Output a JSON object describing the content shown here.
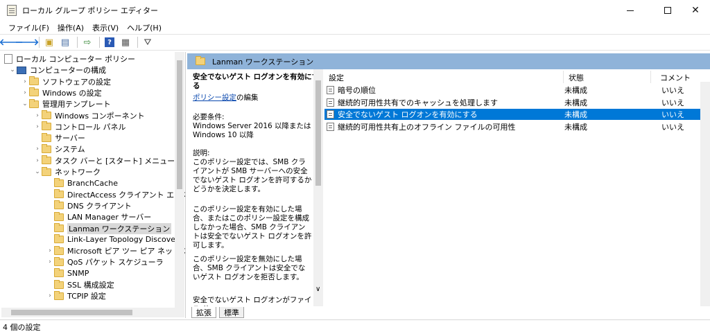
{
  "window": {
    "title": "ローカル グループ ポリシー エディター"
  },
  "menu": [
    "ファイル(F)",
    "操作(A)",
    "表示(V)",
    "ヘルプ(H)"
  ],
  "tree": [
    {
      "label": "ローカル コンピューター ポリシー",
      "icon": "document-icon",
      "expander": ""
    },
    {
      "label": "コンピューターの構成",
      "icon": "computer-icon",
      "expander": "expanded"
    },
    {
      "label": "ソフトウェアの設定",
      "icon": "folder-icon",
      "expander": "collapsed"
    },
    {
      "label": "Windows の設定",
      "icon": "folder-icon",
      "expander": "collapsed"
    },
    {
      "label": "管理用テンプレート",
      "icon": "folder-icon",
      "expander": "expanded"
    },
    {
      "label": "Windows コンポーネント",
      "icon": "folder-icon",
      "expander": "collapsed"
    },
    {
      "label": "コントロール パネル",
      "icon": "folder-icon",
      "expander": "collapsed"
    },
    {
      "label": "サーバー",
      "icon": "folder-icon",
      "expander": ""
    },
    {
      "label": "システム",
      "icon": "folder-icon",
      "expander": "collapsed"
    },
    {
      "label": "タスク バーと [スタート] メニュー",
      "icon": "folder-icon",
      "expander": "collapsed"
    },
    {
      "label": "ネットワーク",
      "icon": "folder-icon",
      "expander": "expanded"
    },
    {
      "label": "BranchCache",
      "icon": "folder-icon",
      "expander": ""
    },
    {
      "label": "DirectAccess クライアント エクスペリ",
      "icon": "folder-icon",
      "expander": ""
    },
    {
      "label": "DNS クライアント",
      "icon": "folder-icon",
      "expander": ""
    },
    {
      "label": "LAN Manager サーバー",
      "icon": "folder-icon",
      "expander": ""
    },
    {
      "label": "Lanman ワークステーション",
      "icon": "folder-icon",
      "expander": "",
      "selected": true
    },
    {
      "label": "Link-Layer Topology Discovery",
      "icon": "folder-icon",
      "expander": ""
    },
    {
      "label": "Microsoft ピア ツー ピア ネットワーク",
      "icon": "folder-icon",
      "expander": "collapsed"
    },
    {
      "label": "QoS パケット スケジューラ",
      "icon": "folder-icon",
      "expander": "collapsed"
    },
    {
      "label": "SNMP",
      "icon": "folder-icon",
      "expander": ""
    },
    {
      "label": "SSL 構成設定",
      "icon": "folder-icon",
      "expander": ""
    },
    {
      "label": "TCPIP 設定",
      "icon": "folder-icon",
      "expander": "collapsed"
    }
  ],
  "right_header": {
    "title": "Lanman ワークステーション"
  },
  "description": {
    "title": "安全でないゲスト ログオンを有効にする",
    "link": "ポリシー設定",
    "link_suffix": "の編集",
    "requirements": "必要条件:\nWindows Server 2016 以降または Windows 10 以降",
    "explanation": "説明:\nこのポリシー設定では、SMB クライアントが SMB サーバーへの安全でないゲスト ログオンを許可するかどうかを決定します。",
    "p2": "このポリシー設定を有効にした場合、またはこのポリシー設定を構成しなかった場合、SMB クライアントは安全でないゲスト ログオンを許可します。",
    "p3": "このポリシー設定を無効にした場合、SMB クライアントは安全でないゲスト ログオンを拒否します。",
    "p4": "安全でないゲスト ログオンがファイル サー"
  },
  "list": {
    "columns": [
      "設定",
      "状態",
      "コメント"
    ],
    "rows": [
      {
        "setting": "暗号の順位",
        "state": "未構成",
        "comment": "いいえ"
      },
      {
        "setting": "継続的可用性共有でのキャッシュを処理します",
        "state": "未構成",
        "comment": "いいえ"
      },
      {
        "setting": "安全でないゲスト ログオンを有効にする",
        "state": "未構成",
        "comment": "いいえ",
        "selected": true
      },
      {
        "setting": "継続的可用性共有上のオフライン ファイルの可用性",
        "state": "未構成",
        "comment": "いいえ"
      }
    ]
  },
  "tabs": [
    "拡張",
    "標準"
  ],
  "status": {
    "text": "4 個の設定"
  },
  "colors": {
    "header_blue": "#8fb3d9",
    "selection_blue": "#0078d7"
  }
}
